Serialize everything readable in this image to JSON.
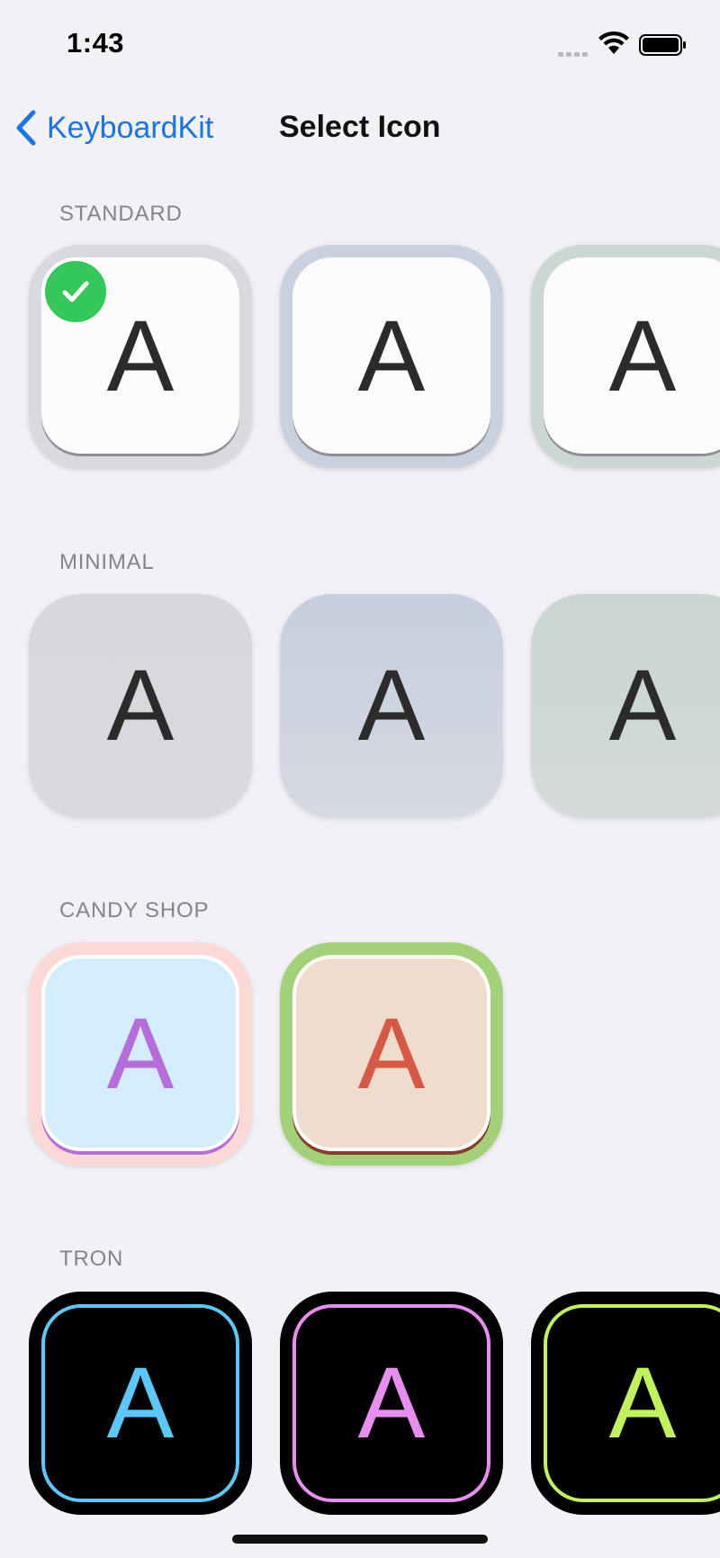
{
  "status": {
    "time": "1:43"
  },
  "nav": {
    "back_label": "KeyboardKit",
    "title": "Select Icon"
  },
  "sections": [
    {
      "title": "STANDARD"
    },
    {
      "title": "MINIMAL"
    },
    {
      "title": "CANDY SHOP"
    },
    {
      "title": "TRON"
    }
  ],
  "icon_letter": "A",
  "selected_icon": "standard-default",
  "colors": {
    "background": "#f2f1f6",
    "accent": "#1a73e8",
    "check": "#34c759",
    "tron_blue": "#5ac8fa",
    "tron_pink": "#e88ef0",
    "tron_green": "#c0f25a",
    "candy_purple": "#b66ddb",
    "candy_red": "#d75843"
  }
}
